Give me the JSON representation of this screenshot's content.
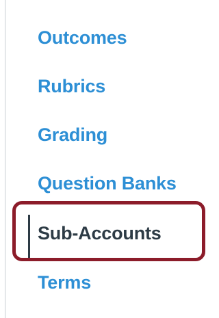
{
  "nav": {
    "items": [
      {
        "label": "Outcomes",
        "active": false
      },
      {
        "label": "Rubrics",
        "active": false
      },
      {
        "label": "Grading",
        "active": false
      },
      {
        "label": "Question Banks",
        "active": false
      },
      {
        "label": "Sub-Accounts",
        "active": true
      },
      {
        "label": "Terms",
        "active": false
      }
    ]
  },
  "colors": {
    "link": "#2d8fd5",
    "active_text": "#2d3b45",
    "highlight_border": "#8c1c2a"
  }
}
